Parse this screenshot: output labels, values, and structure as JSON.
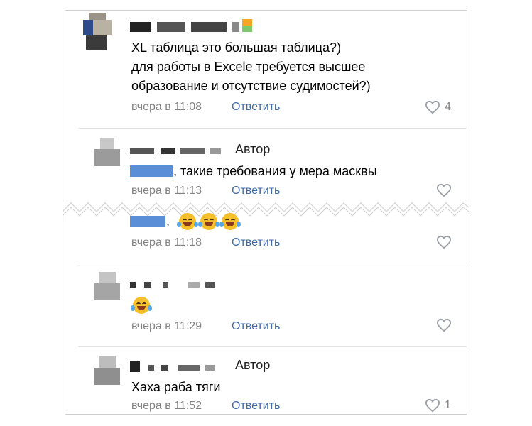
{
  "comments": [
    {
      "text": "XL таблица это большая таблица?)",
      "text2": "для работы в Excele требуется высшее",
      "text3": "образование и отсутствие судимостей?)",
      "time": "вчера в 11:08",
      "reply": "Ответить",
      "likes": "4"
    },
    {
      "author_badge": "Автор",
      "text": ", такие требования у мера масквы",
      "time": "вчера в 11:13",
      "reply": "Ответить",
      "likes": ""
    },
    {
      "text": ",",
      "time": "вчера в 11:18",
      "reply": "Ответить",
      "likes": ""
    },
    {
      "time": "вчера в 11:29",
      "reply": "Ответить",
      "likes": ""
    },
    {
      "author_badge": "Автор",
      "text": "Хаха раба тяги",
      "time": "вчера в 11:52",
      "reply": "Ответить",
      "likes": "1"
    }
  ],
  "icons": {
    "like": "heart-outline-icon",
    "emoji": "tears-of-joy-emoji-icon"
  },
  "colors": {
    "link": "#3f6aa8",
    "meta": "#828282",
    "text": "#000000"
  }
}
